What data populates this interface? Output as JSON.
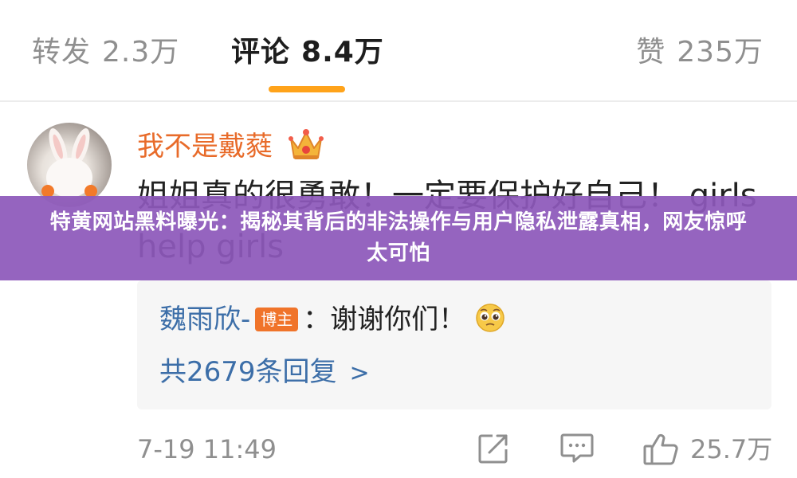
{
  "tabs": {
    "repost": {
      "label": "转发",
      "count": "2.3万"
    },
    "comment": {
      "label": "评论",
      "count": "8.4万"
    },
    "like": {
      "label": "赞",
      "count": "235万"
    }
  },
  "comment": {
    "username": "我不是戴蕤",
    "text": "姐姐真的很勇敢！一定要保护好自己！ girls help girls",
    "reply": {
      "user": "魏雨欣-",
      "badge": "博主",
      "text": "：谢谢你们！"
    },
    "reply_count_label": "共2679条回复",
    "timestamp": "7-19 11:49",
    "like_count": "25.7万"
  },
  "banner": {
    "title": "特黄网站黑料曝光：揭秘其背后的非法操作与用户隐私泄露真相，网友惊呼太可怕"
  },
  "colors": {
    "accent": "#ffa31a",
    "username": "#e86b2a",
    "link": "#3c6ea8",
    "banner": "#8d58ba"
  },
  "icons": [
    "crown-icon",
    "pleading-face-icon",
    "chevron-right-icon",
    "share-icon",
    "comment-icon",
    "thumbs-up-icon"
  ]
}
